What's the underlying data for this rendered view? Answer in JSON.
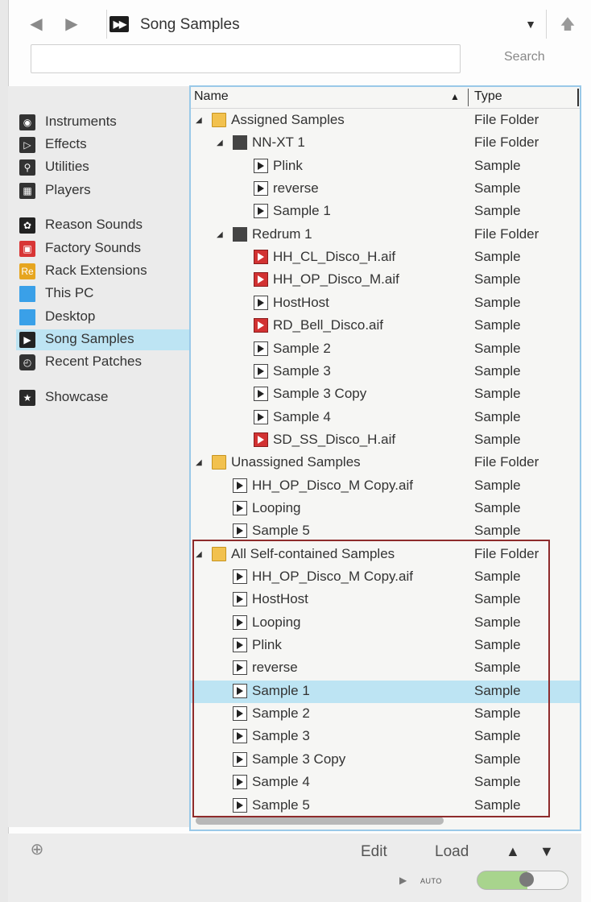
{
  "header": {
    "title": "Song Samples",
    "search_label": "Search",
    "search_value": ""
  },
  "sidebar": {
    "items": [
      {
        "label": "Instruments",
        "icon": "instruments-icon"
      },
      {
        "label": "Effects",
        "icon": "effects-icon"
      },
      {
        "label": "Utilities",
        "icon": "utilities-icon"
      },
      {
        "label": "Players",
        "icon": "players-icon"
      },
      {
        "label": "Reason Sounds",
        "icon": "reason-sounds-icon"
      },
      {
        "label": "Factory Sounds",
        "icon": "factory-sounds-icon"
      },
      {
        "label": "Rack Extensions",
        "icon": "rack-extensions-icon"
      },
      {
        "label": "This PC",
        "icon": "computer-icon"
      },
      {
        "label": "Desktop",
        "icon": "desktop-icon"
      },
      {
        "label": "Song Samples",
        "icon": "song-samples-icon",
        "selected": true
      },
      {
        "label": "Recent Patches",
        "icon": "recent-patches-icon"
      },
      {
        "label": "Showcase",
        "icon": "star-icon"
      }
    ]
  },
  "tree": {
    "columns": {
      "name": "Name",
      "type": "Type"
    },
    "rows": [
      {
        "name": "Assigned Samples",
        "type": "File Folder",
        "kind": "folder"
      },
      {
        "name": "NN-XT 1",
        "type": "File Folder",
        "kind": "device"
      },
      {
        "name": "Plink",
        "type": "Sample",
        "kind": "sample"
      },
      {
        "name": "reverse",
        "type": "Sample",
        "kind": "sample"
      },
      {
        "name": "Sample 1",
        "type": "Sample",
        "kind": "sample"
      },
      {
        "name": "Redrum 1",
        "type": "File Folder",
        "kind": "device"
      },
      {
        "name": "HH_CL_Disco_H.aif",
        "type": "Sample",
        "kind": "aif"
      },
      {
        "name": "HH_OP_Disco_M.aif",
        "type": "Sample",
        "kind": "aif"
      },
      {
        "name": "HostHost",
        "type": "Sample",
        "kind": "sample"
      },
      {
        "name": "RD_Bell_Disco.aif",
        "type": "Sample",
        "kind": "aif"
      },
      {
        "name": "Sample 2",
        "type": "Sample",
        "kind": "sample"
      },
      {
        "name": "Sample 3",
        "type": "Sample",
        "kind": "sample"
      },
      {
        "name": "Sample 3 Copy",
        "type": "Sample",
        "kind": "sample"
      },
      {
        "name": "Sample 4",
        "type": "Sample",
        "kind": "sample"
      },
      {
        "name": "SD_SS_Disco_H.aif",
        "type": "Sample",
        "kind": "aif"
      },
      {
        "name": "Unassigned Samples",
        "type": "File Folder",
        "kind": "folder"
      },
      {
        "name": "HH_OP_Disco_M Copy.aif",
        "type": "Sample",
        "kind": "sample"
      },
      {
        "name": "Looping",
        "type": "Sample",
        "kind": "sample"
      },
      {
        "name": "Sample 5",
        "type": "Sample",
        "kind": "sample"
      },
      {
        "name": "All Self-contained Samples",
        "type": "File Folder",
        "kind": "folder"
      },
      {
        "name": "HH_OP_Disco_M Copy.aif",
        "type": "Sample",
        "kind": "sample"
      },
      {
        "name": "HostHost",
        "type": "Sample",
        "kind": "sample"
      },
      {
        "name": "Looping",
        "type": "Sample",
        "kind": "sample"
      },
      {
        "name": "Plink",
        "type": "Sample",
        "kind": "sample"
      },
      {
        "name": "reverse",
        "type": "Sample",
        "kind": "sample"
      },
      {
        "name": "Sample 1",
        "type": "Sample",
        "kind": "sample",
        "selected": true
      },
      {
        "name": "Sample 2",
        "type": "Sample",
        "kind": "sample"
      },
      {
        "name": "Sample 3",
        "type": "Sample",
        "kind": "sample"
      },
      {
        "name": "Sample 3 Copy",
        "type": "Sample",
        "kind": "sample"
      },
      {
        "name": "Sample 4",
        "type": "Sample",
        "kind": "sample"
      },
      {
        "name": "Sample 5",
        "type": "Sample",
        "kind": "sample"
      }
    ]
  },
  "footer": {
    "edit_label": "Edit",
    "load_label": "Load",
    "auto_label": "AUTO"
  },
  "colors": {
    "selection": "#bde4f3",
    "tree_border": "#9ac9e8",
    "highlight_box": "#8e2b2b",
    "toggle_on": "#a8d48d"
  }
}
